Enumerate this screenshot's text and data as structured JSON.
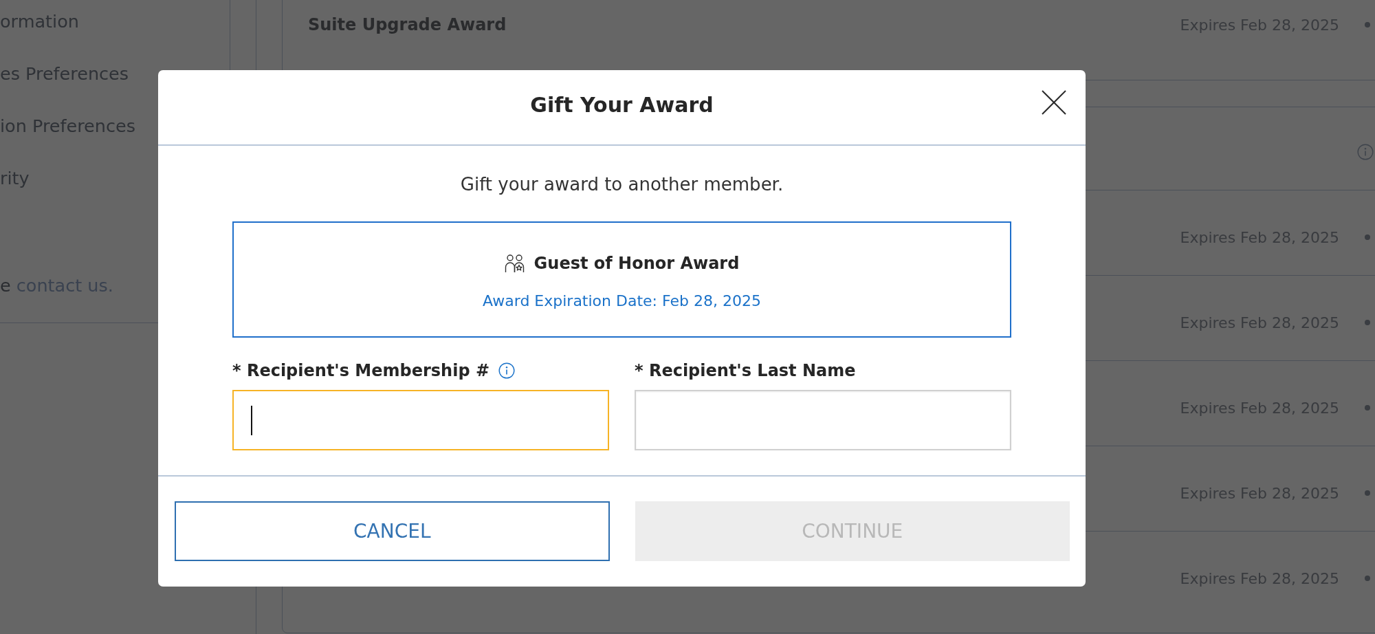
{
  "sidebar": {
    "items": [
      {
        "label": "ormation"
      },
      {
        "label": "es Preferences"
      },
      {
        "label": "ion Preferences"
      },
      {
        "label": "rity"
      }
    ],
    "note": {
      "text": "e",
      "link": "contact us."
    }
  },
  "awards": {
    "title_card": {
      "title": "Suite Upgrade Award",
      "expires": "Expires Feb 28, 2025"
    },
    "list_card": {
      "rows": [
        {
          "expires": "Expires Feb 28, 2025"
        },
        {
          "expires": "Expires Feb 28, 2025"
        },
        {
          "expires": "Expires Feb 28, 2025"
        },
        {
          "expires": "Expires Feb 28, 2025"
        },
        {
          "expires": "Expires Feb 28, 2025"
        }
      ]
    }
  },
  "dialog": {
    "title": "Gift Your Award",
    "intro": "Gift your award to another member.",
    "award": {
      "name": "Guest of Honor Award",
      "expiration": "Award Expiration Date: Feb 28, 2025"
    },
    "fields": [
      {
        "label": "* Recipient's Membership #",
        "info": true,
        "focused": true
      },
      {
        "label": "* Recipient's Last Name",
        "info": false,
        "focused": false
      }
    ],
    "buttons": [
      {
        "label": "CANCEL",
        "kind": "outline",
        "disabled": false
      },
      {
        "label": "CONTINUE",
        "kind": "filled",
        "disabled": true
      }
    ]
  }
}
